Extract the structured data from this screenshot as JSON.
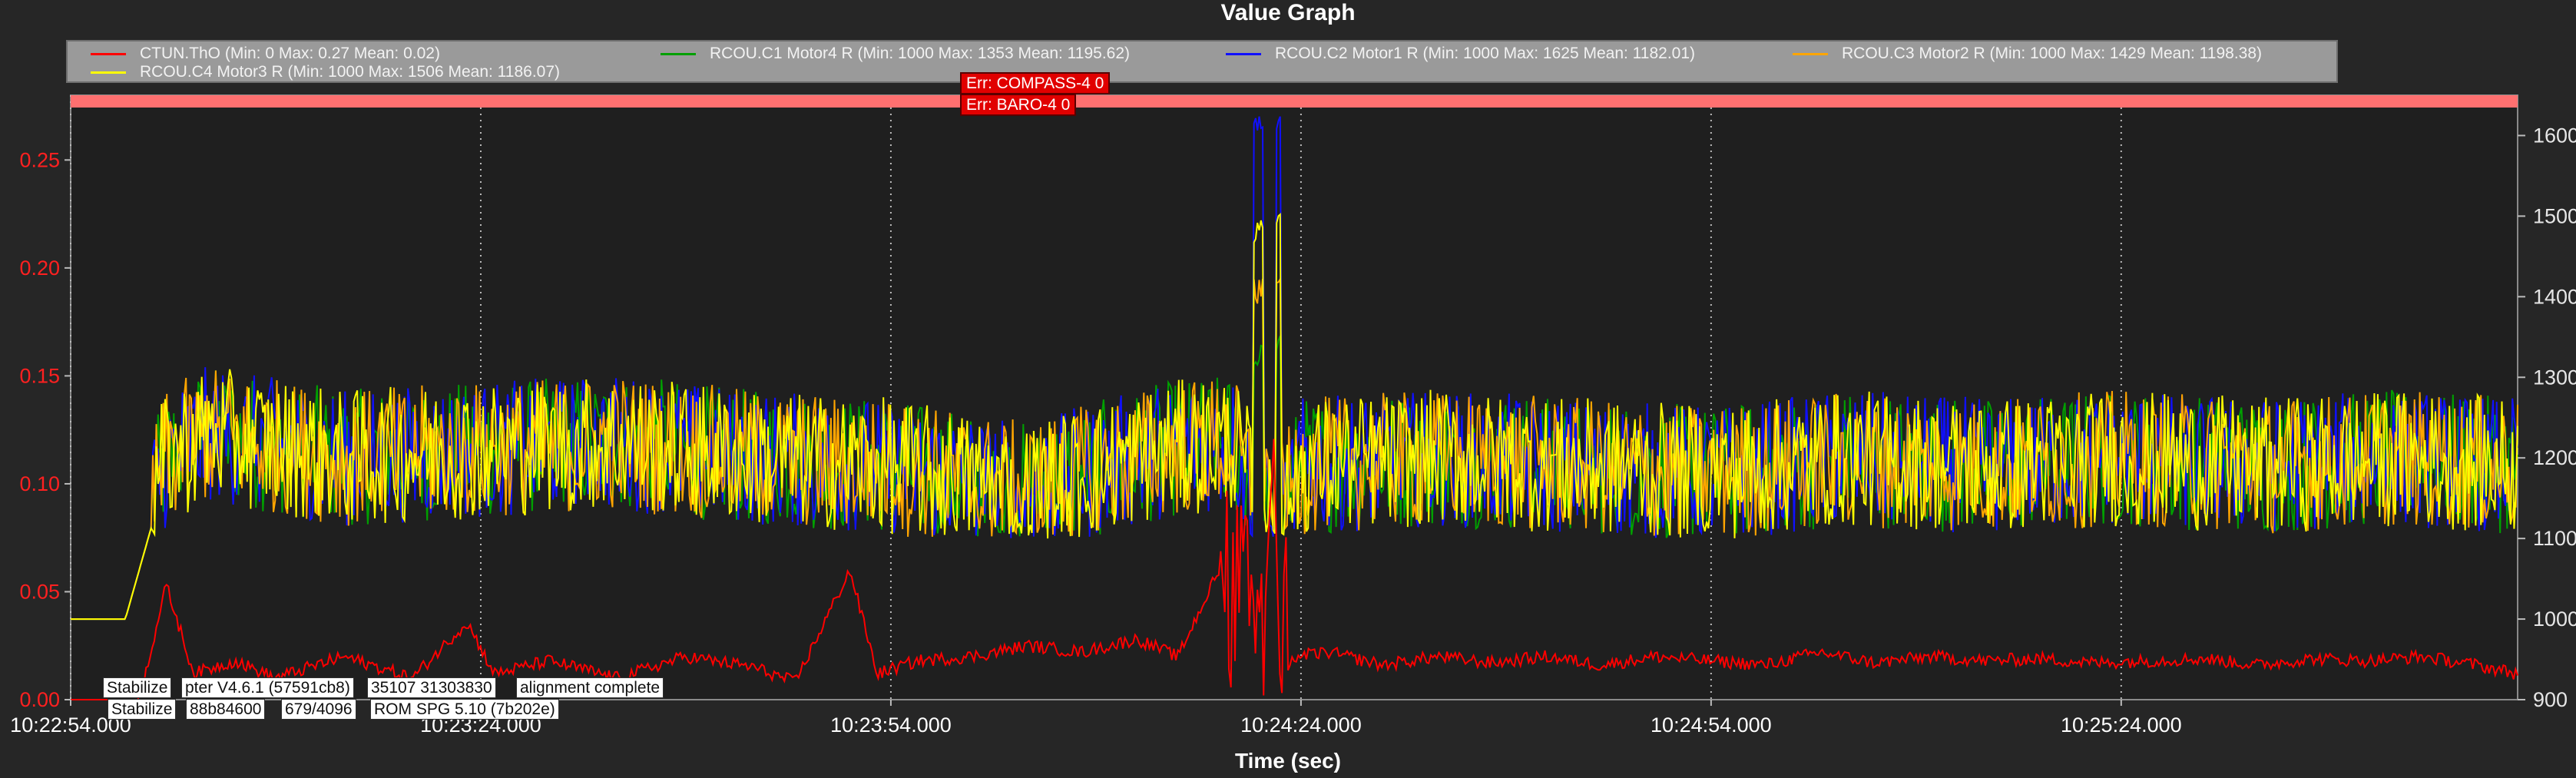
{
  "title": "Value Graph",
  "legend": [
    {
      "label": "CTUN.ThO  (Min: 0 Max: 0.27 Mean: 0.02)",
      "color": "#ff0000"
    },
    {
      "label": "RCOU.C1 Motor4 R (Min: 1000 Max: 1353 Mean: 1195.62)",
      "color": "#00a000"
    },
    {
      "label": "RCOU.C2 Motor1 R (Min: 1000 Max: 1625 Mean: 1182.01)",
      "color": "#1010ff"
    },
    {
      "label": "RCOU.C3 Motor2 R (Min: 1000 Max: 1429 Mean: 1198.38)",
      "color": "#ffa500"
    },
    {
      "label": "RCOU.C4 Motor3 R (Min: 1000 Max: 1506 Mean: 1186.07)",
      "color": "#ffff00"
    }
  ],
  "messages": {
    "errors": [
      "Err: COMPASS-4 0",
      "Err: BARO-4 0"
    ],
    "modes": [
      [
        "Stabilize",
        "pter V4.6.1 (57591cb8)",
        "35107 31303830",
        "alignment complete"
      ],
      [
        "Stabilize",
        "88b84600",
        "679/4096",
        "ROM SPG 5.10 (7b202e)"
      ]
    ]
  },
  "chart_data": {
    "type": "line",
    "title": "Value Graph",
    "xlabel": "Time (sec)",
    "ylabel": "",
    "x_ticks": [
      "10:22:54.000",
      "10:23:24.000",
      "10:23:54.000",
      "10:24:24.000",
      "10:24:54.000",
      "10:25:24.000"
    ],
    "x_tick_seconds": [
      0,
      30,
      60,
      90,
      120,
      150
    ],
    "xlim": [
      0,
      179
    ],
    "ylim_left": [
      0,
      0.28
    ],
    "y_ticks_left": [
      "0.00",
      "0.05",
      "0.10",
      "0.15",
      "0.20",
      "0.25"
    ],
    "ylim_right": [
      900,
      1650
    ],
    "y_ticks_right": [
      "900",
      "1000",
      "1100",
      "1200",
      "1300",
      "1400",
      "1500",
      "1600"
    ],
    "grid": true,
    "legend_position": "top",
    "series": [
      {
        "name": "CTUN.ThO",
        "axis": "left",
        "color": "#ff0000",
        "min": 0,
        "max": 0.27,
        "mean": 0.02,
        "points": [
          [
            0,
            0.0
          ],
          [
            5,
            0.0
          ],
          [
            7,
            0.053
          ],
          [
            9,
            0.012
          ],
          [
            12,
            0.018
          ],
          [
            15,
            0.01
          ],
          [
            20,
            0.02
          ],
          [
            25,
            0.01
          ],
          [
            29,
            0.036
          ],
          [
            31,
            0.012
          ],
          [
            35,
            0.018
          ],
          [
            40,
            0.01
          ],
          [
            45,
            0.02
          ],
          [
            50,
            0.015
          ],
          [
            53,
            0.008
          ],
          [
            57,
            0.06
          ],
          [
            59,
            0.012
          ],
          [
            62,
            0.018
          ],
          [
            66,
            0.02
          ],
          [
            70,
            0.025
          ],
          [
            74,
            0.022
          ],
          [
            78,
            0.028
          ],
          [
            81,
            0.02
          ],
          [
            84,
            0.06
          ],
          [
            85,
            0.0
          ],
          [
            86,
            0.09
          ],
          [
            87,
            0.0
          ],
          [
            88,
            0.12
          ],
          [
            88.5,
            0.0
          ],
          [
            89.5,
            0.02
          ],
          [
            92,
            0.022
          ],
          [
            96,
            0.016
          ],
          [
            100,
            0.02
          ],
          [
            104,
            0.017
          ],
          [
            108,
            0.02
          ],
          [
            112,
            0.016
          ],
          [
            116,
            0.02
          ],
          [
            120,
            0.018
          ],
          [
            124,
            0.016
          ],
          [
            128,
            0.022
          ],
          [
            132,
            0.017
          ],
          [
            136,
            0.02
          ],
          [
            140,
            0.018
          ],
          [
            144,
            0.019
          ],
          [
            148,
            0.017
          ],
          [
            152,
            0.018
          ],
          [
            156,
            0.019
          ],
          [
            160,
            0.016
          ],
          [
            164,
            0.019
          ],
          [
            168,
            0.018
          ],
          [
            172,
            0.02
          ],
          [
            176,
            0.016
          ],
          [
            179,
            0.012
          ]
        ]
      },
      {
        "name": "RCOU.C1 Motor4 R",
        "axis": "right",
        "color": "#00a000",
        "min": 1000,
        "max": 1353,
        "mean": 1195.62
      },
      {
        "name": "RCOU.C2 Motor1 R",
        "axis": "right",
        "color": "#1010ff",
        "min": 1000,
        "max": 1625,
        "mean": 1182.01
      },
      {
        "name": "RCOU.C3 Motor2 R",
        "axis": "right",
        "color": "#ffa500",
        "min": 1000,
        "max": 1429,
        "mean": 1198.38
      },
      {
        "name": "RCOU.C4 Motor3 R",
        "axis": "right",
        "color": "#ffff00",
        "min": 1000,
        "max": 1506,
        "mean": 1186.07,
        "points": [
          [
            0,
            1000
          ],
          [
            4,
            1000
          ],
          [
            5,
            1120
          ],
          [
            6,
            1150
          ],
          [
            7,
            1200
          ],
          [
            10,
            1230
          ],
          [
            20,
            1200
          ],
          [
            30,
            1210
          ],
          [
            40,
            1220
          ],
          [
            50,
            1200
          ],
          [
            60,
            1190
          ],
          [
            70,
            1160
          ],
          [
            80,
            1210
          ],
          [
            85,
            1220
          ],
          [
            88,
            1110
          ],
          [
            90,
            1190
          ],
          [
            100,
            1200
          ],
          [
            110,
            1190
          ],
          [
            120,
            1180
          ],
          [
            130,
            1200
          ],
          [
            140,
            1190
          ],
          [
            150,
            1200
          ],
          [
            160,
            1190
          ],
          [
            170,
            1200
          ],
          [
            179,
            1190
          ]
        ]
      }
    ]
  }
}
